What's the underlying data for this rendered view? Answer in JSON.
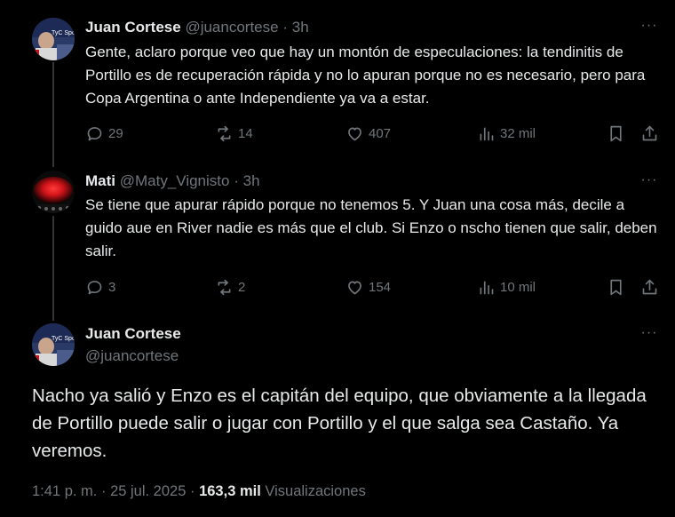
{
  "tweets": [
    {
      "name": "Juan Cortese",
      "handle": "@juancortese",
      "separator": "·",
      "time": "3h",
      "avatar_icon": "tyc-sports-avatar",
      "text": "Gente, aclaro porque veo que hay un montón de especulaciones: la tendinitis de Portillo es de recuperación rápida y no lo apuran porque no es necesario, pero para Copa Argentina o ante Independiente ya va a estar.",
      "replies": "29",
      "reposts": "14",
      "likes": "407",
      "views": "32 mil"
    },
    {
      "name": "Mati",
      "handle": "@Maty_Vignisto",
      "separator": "·",
      "time": "3h",
      "avatar_icon": "red-glow-avatar",
      "text": "Se tiene que apurar rápido porque no tenemos 5. Y Juan una cosa más, decile a guido aue en River nadie es más que el club. Si Enzo o nscho tienen que salir, deben salir.",
      "replies": "3",
      "reposts": "2",
      "likes": "154",
      "views": "10 mil"
    }
  ],
  "main_tweet": {
    "name": "Juan Cortese",
    "handle": "@juancortese",
    "avatar_icon": "tyc-sports-avatar",
    "text": "Nacho ya salió y Enzo es el capitán del equipo, que obviamente a la llegada de Portillo puede salir o jugar con Portillo y el que salga sea Castaño. Ya veremos.",
    "time": "1:41 p. m.",
    "dot": "·",
    "date": "25 jul. 2025",
    "dot2": "·",
    "views_count": "163,3 mil",
    "views_label": "Visualizaciones"
  },
  "more_label": "···",
  "colors": {
    "background": "#000000",
    "text": "#e7e9ea",
    "muted": "#71767b",
    "thread_line": "#333639"
  }
}
